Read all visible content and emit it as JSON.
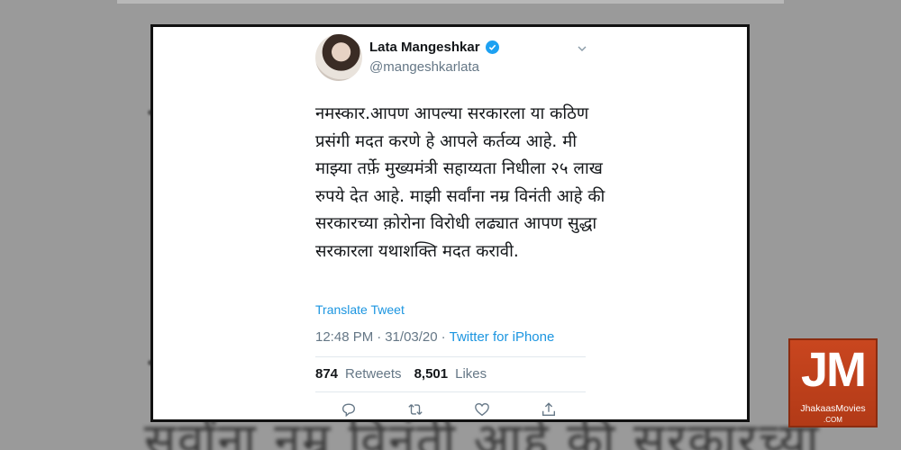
{
  "tweet": {
    "display_name": "Lata Mangeshkar",
    "handle": "@mangeshkarlata",
    "verified_icon": "verified-badge-icon",
    "text": "नमस्कार.आपण आपल्या सरकारला या कठिण प्रसंगी मदत करणे हे आपले कर्तव्य आहे. मी माझ्या तर्फ़े मुख्यमंत्री सहाय्यता निधीला २५ लाख रुपये देत आहे. माझी सर्वांना नम्र विनंती आहे की सरकारच्या क़ोरोना विरोधी लढ्यात आपण सुद्धा सरकारला यथाशक्ति मदत करावी.",
    "translate_label": "Translate Tweet",
    "time": "12:48 PM",
    "separator": "·",
    "date": "31/03/20",
    "source": "Twitter for iPhone",
    "retweets_count": "874",
    "retweets_label": "Retweets",
    "likes_count": "8,501",
    "likes_label": "Likes",
    "action_icons": [
      "reply-icon",
      "retweet-icon",
      "like-icon",
      "share-icon"
    ],
    "link_color": "#1b95e0",
    "verified_color": "#1da1f2"
  },
  "background": {
    "blurred_text": "सर्वांना नम्र विनंती आहे की सरकारच्या"
  },
  "watermark": {
    "mark": "JM",
    "name": "JhakaasMovies",
    "domain": ".COM",
    "color": "#c9461f"
  }
}
